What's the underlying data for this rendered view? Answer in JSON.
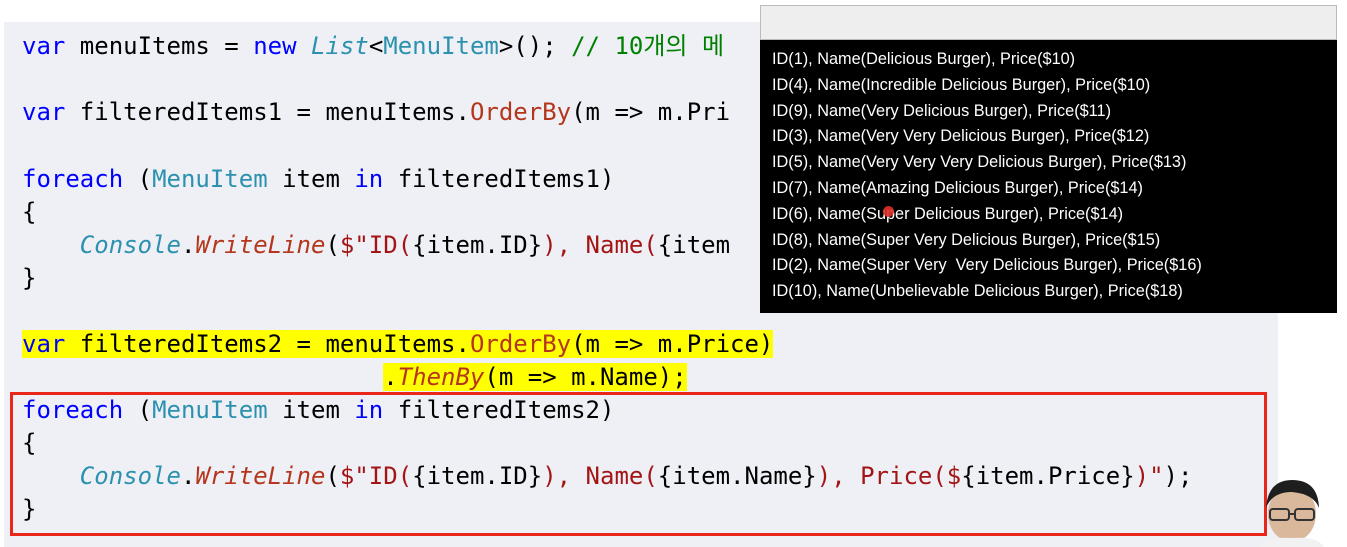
{
  "code": {
    "l1": {
      "kw1": "var",
      "p1": " menuItems = ",
      "kw2": "new",
      "sp": " ",
      "list": "List",
      "lt": "<",
      "ty": "MenuItem",
      "gt": ">();",
      "cm": " // 10개의 메"
    },
    "l2": {
      "kw": "var",
      "p1": " filteredItems1 = menuItems.",
      "m": "OrderBy",
      "p2": "(m => m.Pri"
    },
    "l3": {
      "kw": "foreach",
      "p1": " (",
      "ty": "MenuItem",
      "p2": " item ",
      "kw2": "in",
      "p3": " filteredItems1)"
    },
    "l4": "{",
    "l5": {
      "indent": "    ",
      "cls": "Console",
      "dot": ".",
      "m": "WriteLine",
      "p1": "(",
      "s1": "$\"ID(",
      "p2": "{item.ID}",
      "s2": "), Name(",
      "p3": "{item"
    },
    "l6": "}",
    "l7": {
      "kw": "var",
      "p1": " filteredItems2 = menuItems.",
      "m": "OrderBy",
      "p2": "(m => m.Price)"
    },
    "l8": {
      "indent": "                         ",
      "dot": ".",
      "m": "ThenBy",
      "p1": "(m => m.Name);"
    },
    "l9": {
      "kw": "foreach",
      "p1": " (",
      "ty": "MenuItem",
      "p2": " item ",
      "kw2": "in",
      "p3": " filteredItems2)"
    },
    "l10": "{",
    "l11": {
      "indent": "    ",
      "cls": "Console",
      "dot": ".",
      "m": "WriteLine",
      "p1": "(",
      "s1": "$\"ID(",
      "p2": "{item.ID}",
      "s2": "), Name(",
      "p3": "{item.Name}",
      "s3": "), Price($",
      "p4": "{item.Price}",
      "s4": ")\"",
      "p5": ");"
    },
    "l12": "}"
  },
  "console": {
    "lines": [
      "ID(1), Name(Delicious Burger), Price($10)",
      "ID(4), Name(Incredible Delicious Burger), Price($10)",
      "ID(9), Name(Very Delicious Burger), Price($11)",
      "ID(3), Name(Very Very Delicious Burger), Price($12)",
      "ID(5), Name(Very Very Very Delicious Burger), Price($13)",
      "ID(7), Name(Amazing Delicious Burger), Price($14)",
      "ID(6), Name(Super Delicious Burger), Price($14)",
      "ID(8), Name(Super Very Delicious Burger), Price($15)",
      "ID(2), Name(Super Very  Very Delicious Burger), Price($16)",
      "ID(10), Name(Unbelievable Delicious Burger), Price($18)"
    ]
  },
  "colors": {
    "keyword": "#0000ff",
    "type": "#2b91af",
    "method": "#b5361c",
    "string": "#a31515",
    "comment": "#008000",
    "highlight": "#ffff00",
    "box_border": "#e8271a"
  }
}
